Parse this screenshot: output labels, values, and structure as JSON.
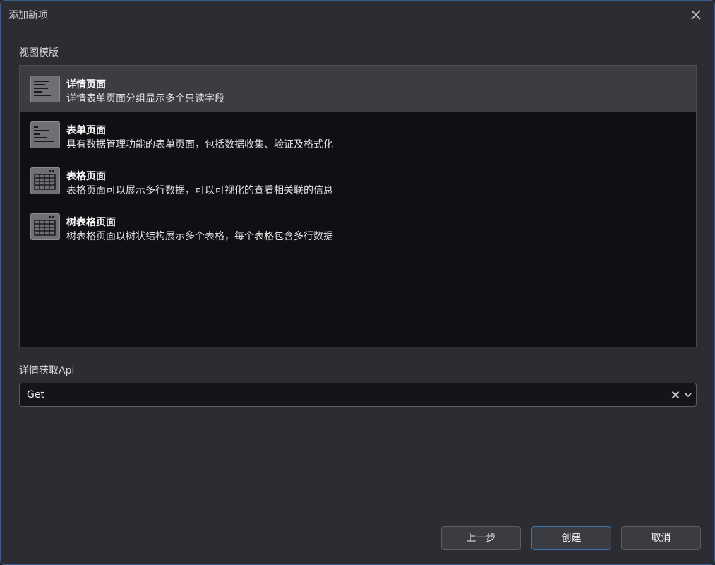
{
  "dialog": {
    "title": "添加新项"
  },
  "template_section": {
    "label": "视图模版",
    "selected_index": 0,
    "items": [
      {
        "title": "详情页面",
        "description": "详情表单页面分组显示多个只读字段",
        "icon": "detail-page-icon"
      },
      {
        "title": "表单页面",
        "description": "具有数据管理功能的表单页面，包括数据收集、验证及格式化",
        "icon": "form-page-icon"
      },
      {
        "title": "表格页面",
        "description": "表格页面可以展示多行数据，可以可视化的查看相关联的信息",
        "icon": "table-page-icon"
      },
      {
        "title": "树表格页面",
        "description": "树表格页面以树状结构展示多个表格，每个表格包含多行数据",
        "icon": "tree-table-page-icon"
      }
    ]
  },
  "api_section": {
    "label": "详情获取Api",
    "selected_value": "Get"
  },
  "footer": {
    "prev_label": "上一步",
    "create_label": "创建",
    "cancel_label": "取消"
  },
  "colors": {
    "accent_border": "#3c74b0",
    "selected_row": "#3b3d42",
    "list_background": "#0f1013"
  }
}
